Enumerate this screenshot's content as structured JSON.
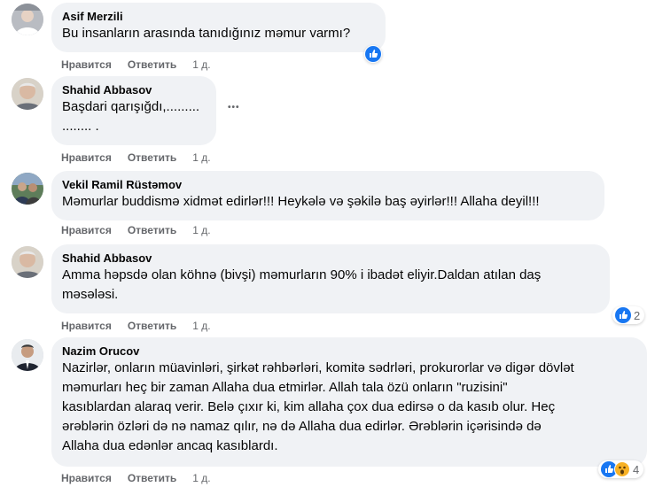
{
  "colors": {
    "bubble_bg": "#f0f2f5",
    "action_text": "#65676b",
    "like_blue": "#1877f2",
    "wow_yellow": "#f7b125"
  },
  "comments": [
    {
      "author": "Asif Merzili",
      "lines": [
        "Bu insanların arasında tanıdığınız məmur varmı?"
      ],
      "like_label": "Нравится",
      "reply_label": "Ответить",
      "time": "1 д.",
      "reactions": {
        "icons": [
          "like-icon"
        ],
        "count": ""
      }
    },
    {
      "author": "Shahid Abbasov",
      "lines": [
        "Başdari qarışığdı,.........",
        "........ ."
      ],
      "like_label": "Нравится",
      "reply_label": "Ответить",
      "time": "1 д.",
      "more": "•••"
    },
    {
      "author": "Vekil Ramil Rüstəmov",
      "lines": [
        "Məmurlar buddismə xidmət edirlər!!! Heykələ və şəkilə baş əyirlər!!! Allaha deyil!!!"
      ],
      "like_label": "Нравится",
      "reply_label": "Ответить",
      "time": "1 д."
    },
    {
      "author": "Shahid Abbasov",
      "lines": [
        "Amma həpsdə olan köhnə (bivşi) məmurların 90% i ibadət eliyir.Daldan atılan daş",
        "məsələsi."
      ],
      "like_label": "Нравится",
      "reply_label": "Ответить",
      "time": "1 д.",
      "reactions": {
        "icons": [
          "like-icon"
        ],
        "count": "2"
      }
    },
    {
      "author": "Nazim Orucov",
      "lines": [
        "Nazirlər, onların müavinləri, şirkət rəhbərləri, komitə sədrləri, prokurorlar və digər dövlət",
        "məmurları heç bir zaman Allaha dua etmirlər. Allah tala özü onların \"ruzisini\"",
        "kasıblardan alaraq verir. Belə çıxır ki, kim allaha çox dua edirsə o da kasıb olur. Heç",
        "ərəblərin özləri də nə namaz qılır, nə də Allaha dua edirlər. Ərəblərin içərisində də",
        "Allaha dua edənlər ancaq kasıblardı."
      ],
      "like_label": "Нравится",
      "reply_label": "Ответить",
      "time": "1 д.",
      "reactions": {
        "icons": [
          "like-icon",
          "wow-icon"
        ],
        "count": "4"
      }
    }
  ]
}
